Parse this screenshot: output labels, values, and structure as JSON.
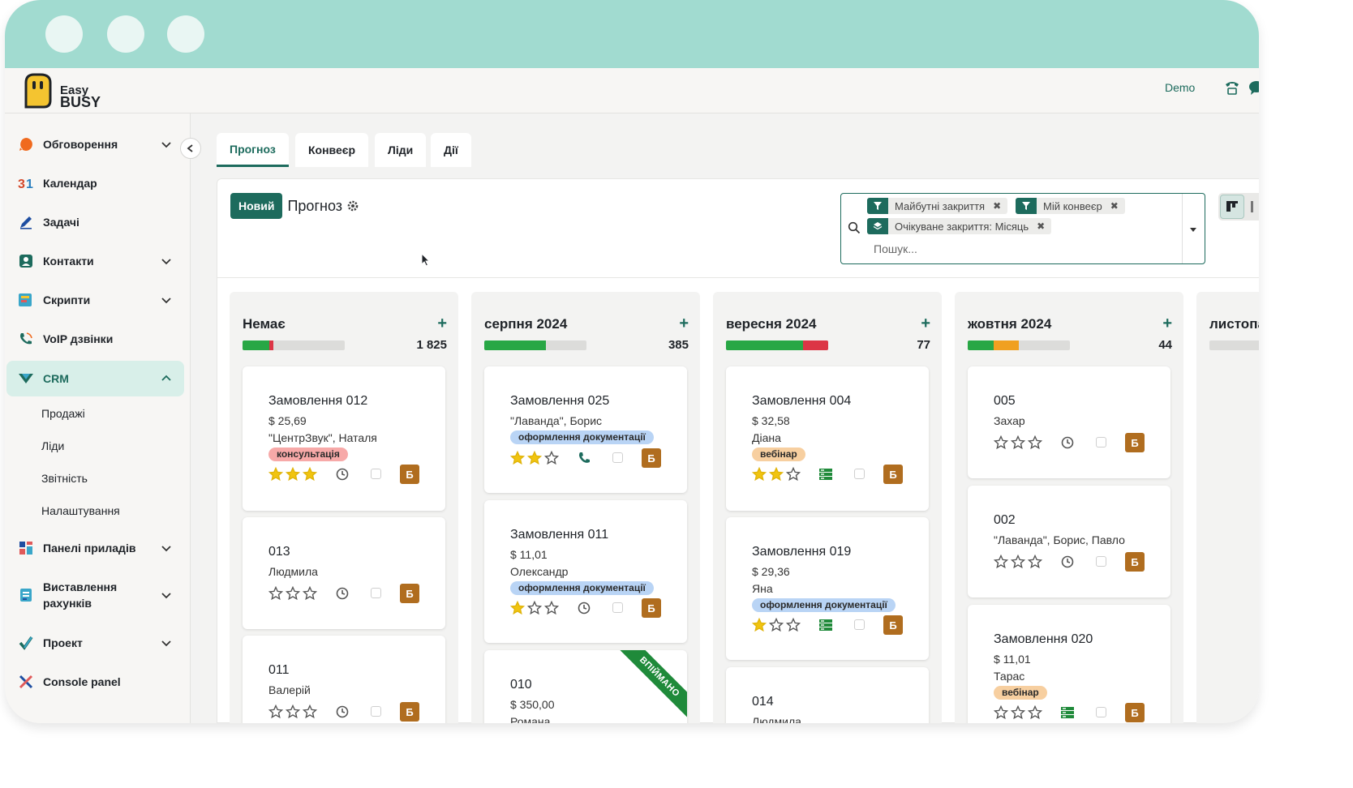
{
  "app": {
    "brand_line1": "Easy",
    "brand_line2": "BUSY",
    "user": "Demo"
  },
  "colors": {
    "accent": "#1d6b5d",
    "chrome": "#a1dbd0",
    "avatar": "#b06d1f",
    "won": "#1f8a3a"
  },
  "sidebar": {
    "items": [
      {
        "label": "Обговорення",
        "icon": "chat-bubble-icon"
      },
      {
        "label": "Календар",
        "icon": "calendar-icon"
      },
      {
        "label": "Задачі",
        "icon": "pencil-icon"
      },
      {
        "label": "Контакти",
        "icon": "contacts-icon"
      },
      {
        "label": "Скрипти",
        "icon": "scripts-icon"
      },
      {
        "label": "VoIP дзвінки",
        "icon": "phone-icon"
      },
      {
        "label": "CRM",
        "icon": "crm-icon"
      },
      {
        "label": "Панелі приладів",
        "icon": "dashboard-icon"
      },
      {
        "label": "Виставлення рахунків",
        "icon": "invoice-icon"
      },
      {
        "label": "Проект",
        "icon": "check-icon"
      },
      {
        "label": "Console panel",
        "icon": "console-icon"
      }
    ],
    "crm_sub": [
      "Продажі",
      "Ліди",
      "Звітність",
      "Налаштування"
    ]
  },
  "tabs": [
    "Прогноз",
    "Конвеєр",
    "Ліди",
    "Дії"
  ],
  "control": {
    "new_label": "Новий",
    "title": "Прогноз"
  },
  "search": {
    "facets": [
      "Майбутні закриття",
      "Мій конвеєр",
      "Очікуване закриття: Місяць"
    ],
    "placeholder": "Пошук..."
  },
  "columns": [
    {
      "title": "Немає",
      "count": "1 825",
      "progress": [
        {
          "color": "#28a745",
          "frac": 0.26
        },
        {
          "color": "#dc3545",
          "frac": 0.04
        }
      ]
    },
    {
      "title": "серпня 2024",
      "count": "385",
      "progress": [
        {
          "color": "#28a745",
          "frac": 0.6
        }
      ]
    },
    {
      "title": "вересня 2024",
      "count": "77",
      "progress": [
        {
          "color": "#28a745",
          "frac": 0.75
        },
        {
          "color": "#dc3545",
          "frac": 0.25
        }
      ]
    },
    {
      "title": "жовтня 2024",
      "count": "44",
      "progress": [
        {
          "color": "#28a745",
          "frac": 0.25
        },
        {
          "color": "#f0a020",
          "frac": 0.25
        }
      ]
    },
    {
      "title": "листопа",
      "count": "",
      "progress": []
    }
  ],
  "cards": {
    "c0_0": {
      "title": "Замовлення 012",
      "amount": "$ 25,69",
      "contact": "\"ЦентрЗвук\", Наталя",
      "tag": "консультація",
      "avatar": "Б",
      "stars": 3
    },
    "c0_1": {
      "title": "013",
      "contact": "Людмила",
      "avatar": "Б",
      "stars": 0
    },
    "c0_2": {
      "title": "011",
      "contact": "Валерій",
      "avatar": "Б",
      "stars": 0
    },
    "c1_0": {
      "title": "Замовлення 025",
      "contact": "\"Лаванда\", Борис",
      "tag": "оформлення документації",
      "avatar": "Б",
      "stars": 2
    },
    "c1_1": {
      "title": "Замовлення 011",
      "amount": "$ 11,01",
      "contact": "Олександр",
      "tag": "оформлення документації",
      "avatar": "Б",
      "stars": 1
    },
    "c1_2": {
      "title": "010",
      "amount": "$ 350,00",
      "contact": "Романа",
      "ribbon": "ВПІЙМАНО"
    },
    "c2_0": {
      "title": "Замовлення 004",
      "amount": "$ 32,58",
      "contact": "Діана",
      "tag": "вебінар",
      "avatar": "Б",
      "stars": 2
    },
    "c2_1": {
      "title": "Замовлення 019",
      "amount": "$ 29,36",
      "contact": "Яна",
      "tag": "оформлення документації",
      "avatar": "Б",
      "stars": 1
    },
    "c2_2": {
      "title": "014",
      "contact": "Людмила"
    },
    "c3_0": {
      "title": "005",
      "contact": "Захар",
      "avatar": "Б",
      "stars": 0
    },
    "c3_1": {
      "title": "002",
      "contact": "\"Лаванда\", Борис, Павло",
      "avatar": "Б",
      "stars": 0
    },
    "c3_2": {
      "title": "Замовлення 020",
      "amount": "$ 11,01",
      "contact": "Тарас",
      "tag": "вебінар",
      "avatar": "Б",
      "stars": 0
    }
  }
}
